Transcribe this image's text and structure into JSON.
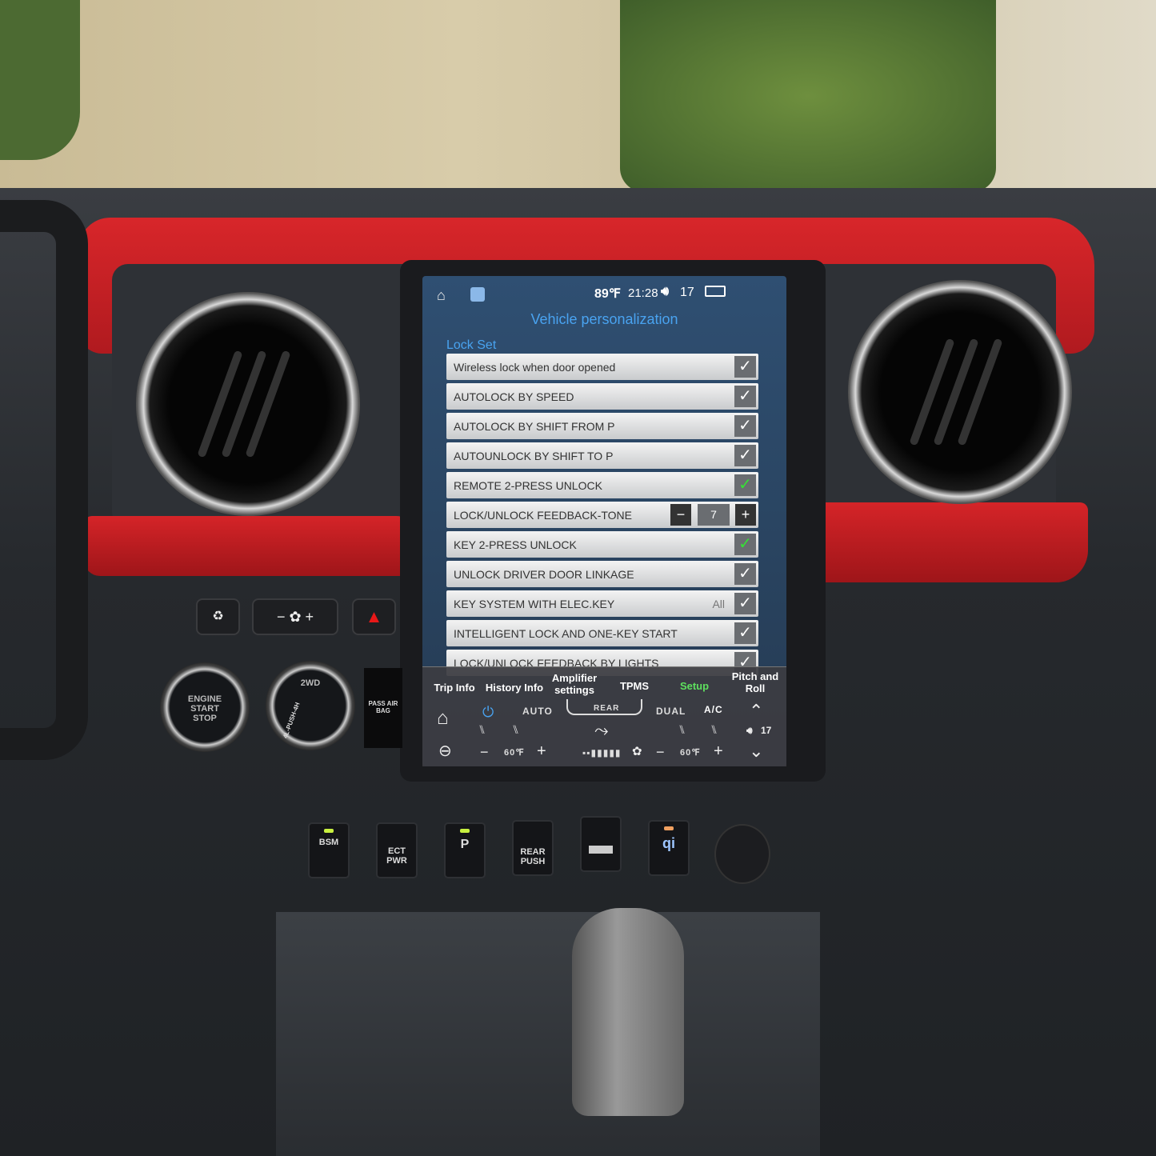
{
  "status_bar": {
    "temperature": "89℉",
    "time": "21:28",
    "volume_icon": "speaker-icon",
    "volume": "17",
    "icons": [
      "home-icon",
      "app-icon",
      "recent-apps-icon"
    ]
  },
  "screen": {
    "title": "Vehicle personalization",
    "section": "Lock Set",
    "rows": [
      {
        "label": "Wireless lock when door opened",
        "checked": true
      },
      {
        "label": "AUTOLOCK BY SPEED",
        "checked": true
      },
      {
        "label": "AUTOLOCK BY SHIFT FROM P",
        "checked": true
      },
      {
        "label": "AUTOUNLOCK BY SHIFT TO P",
        "checked": true
      },
      {
        "label": "REMOTE 2-PRESS UNLOCK",
        "checked": true
      },
      {
        "label": "LOCK/UNLOCK FEEDBACK-TONE",
        "value": "7",
        "minus": "−",
        "plus": "+"
      },
      {
        "label": "KEY 2-PRESS UNLOCK",
        "checked": true
      },
      {
        "label": "UNLOCK DRIVER DOOR LINKAGE",
        "checked": true
      },
      {
        "label": "KEY SYSTEM WITH ELEC.KEY",
        "option": "All",
        "checked": true
      },
      {
        "label": "INTELLIGENT LOCK AND ONE-KEY START",
        "checked": true
      },
      {
        "label": "LOCK/UNLOCK FEEDBACK BY LIGHTS",
        "checked": true
      }
    ],
    "check_mark": "✓",
    "accent": "#49a3f0",
    "active_check": "#36e036"
  },
  "tabs": [
    {
      "label": "Trip Info"
    },
    {
      "label": "History Info"
    },
    {
      "label": "Amplifier settings"
    },
    {
      "label": "TPMS"
    },
    {
      "label": "Setup",
      "active": true
    },
    {
      "label": "Pitch and Roll"
    }
  ],
  "tab_active_color": "#5ee05e",
  "climate": {
    "auto": "AUTO",
    "rear": "REAR",
    "dual": "DUAL",
    "ac": "A/C",
    "left_temp": "60℉",
    "right_temp": "60℉",
    "minus": "−",
    "plus": "+",
    "volume": "17",
    "fan_level": 2
  },
  "physical": {
    "engine": "ENGINE START STOP",
    "drive": "2WD",
    "drive_modes": "4L-PUSH-4H",
    "airbag": "PASS AIR BAG",
    "bsm": "BSM",
    "ect": "ECT PWR",
    "parking": "P",
    "rear": "REAR PUSH",
    "qi": "qi",
    "fan_minus": "−",
    "fan_plus": "+",
    "hazard": "▲",
    "recirc": "recirculation-icon"
  }
}
